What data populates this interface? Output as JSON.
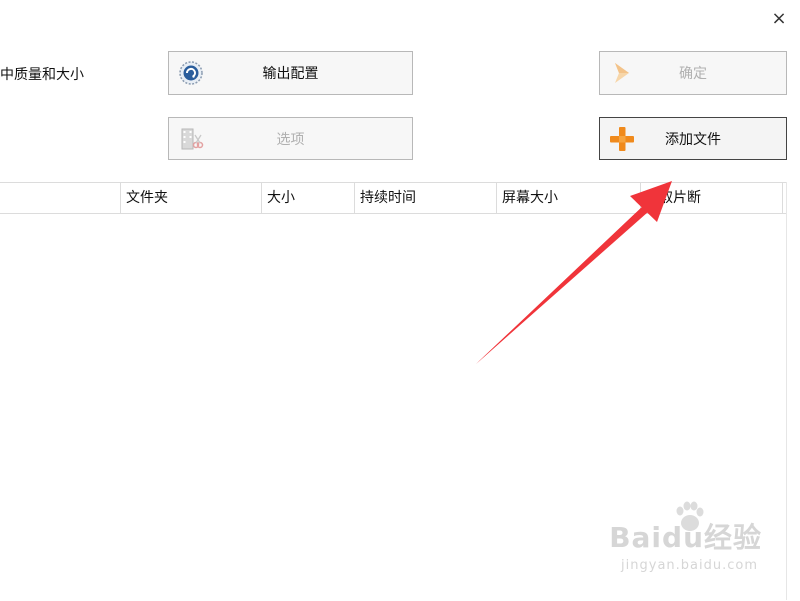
{
  "window": {
    "close_label": "×",
    "header_text": "中质量和大小"
  },
  "toolbar": {
    "output_config_label": "输出配置",
    "options_label": "选项",
    "ok_label": "确定",
    "add_file_label": "添加文件"
  },
  "icons": {
    "output_config": "gear-globe-icon",
    "options": "film-scissors-icon",
    "ok": "arrow-right-icon",
    "add_file": "plus-icon"
  },
  "table": {
    "columns": [
      "",
      "文件夹",
      "大小",
      "持续时间",
      "屏幕大小",
      "取片断"
    ]
  },
  "watermark": {
    "main": "Baidu经验",
    "sub": "jingyan.baidu.com"
  },
  "colors": {
    "annotation_arrow": "#f0343a",
    "add_icon": "#f08a1c",
    "button_border": "#b8b8b8"
  }
}
